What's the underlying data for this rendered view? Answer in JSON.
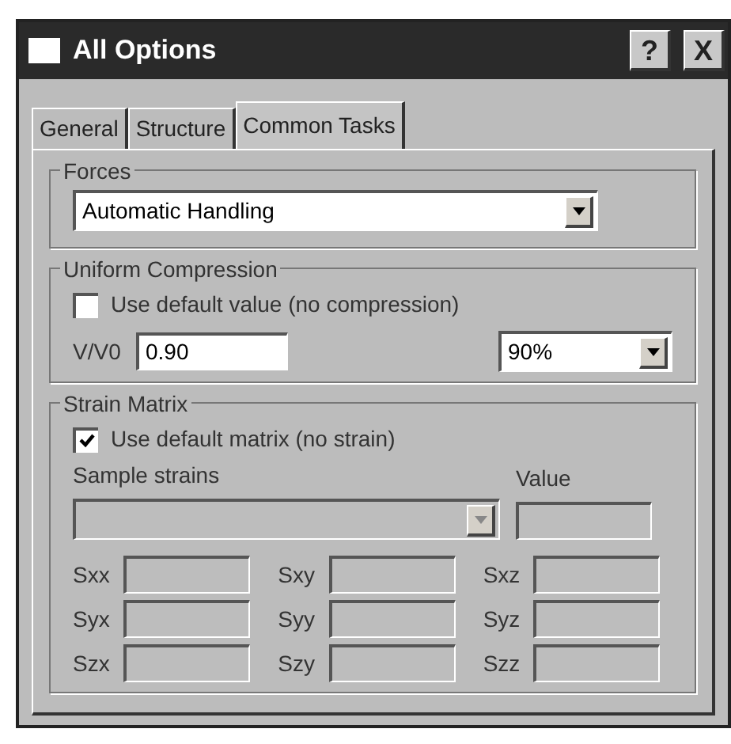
{
  "window": {
    "title": "All Options",
    "buttons": [
      "?",
      "X"
    ]
  },
  "tabs": [
    {
      "label": "General",
      "selected": false
    },
    {
      "label": "Structure",
      "selected": false
    },
    {
      "label": "Common Tasks",
      "selected": true
    }
  ],
  "forces": {
    "title": "Forces",
    "dropdown": {
      "value": "Automatic Handling"
    }
  },
  "uniform_compression": {
    "title": "Uniform Compression",
    "checkbox": {
      "label": "Use default value (no compression)",
      "checked": false
    },
    "ratio": {
      "label": "V/V0",
      "value": "0.90",
      "disabled": false
    },
    "percent_dropdown": {
      "value": "90%",
      "disabled": false
    }
  },
  "strain_matrix": {
    "title": "Strain Matrix",
    "checkbox": {
      "label": "Use default matrix (no strain)",
      "checked": true
    },
    "sample_label": "Sample strains",
    "value_label": "Value",
    "sample_dropdown": {
      "disabled": true
    },
    "value_field": {
      "disabled": true
    },
    "cells": [
      {
        "label": "Sxx",
        "disabled": true
      },
      {
        "label": "Sxy",
        "disabled": true
      },
      {
        "label": "Sxz",
        "disabled": true
      },
      {
        "label": "Syx",
        "disabled": true
      },
      {
        "label": "Syy",
        "disabled": true
      },
      {
        "label": "Syz",
        "disabled": true
      },
      {
        "label": "Szx",
        "disabled": true
      },
      {
        "label": "Szy",
        "disabled": true
      },
      {
        "label": "Szz",
        "disabled": true
      }
    ]
  }
}
